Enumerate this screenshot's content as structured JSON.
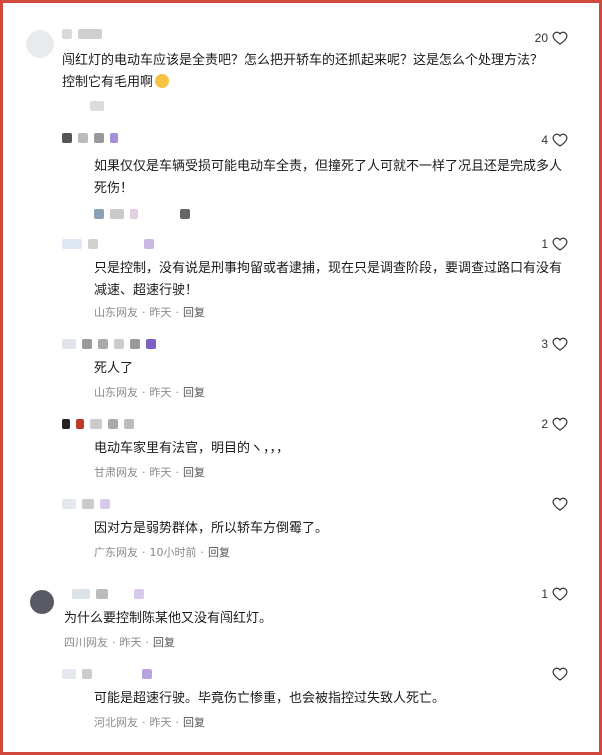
{
  "comments": [
    {
      "likes": "20",
      "text": "闯红灯的电动车应该是全责吧？怎么把开轿车的还抓起来呢？这是怎么个处理方法？控制它有毛用啊"
    },
    {
      "likes": "4",
      "text": "如果仅仅是车辆受损可能电动车全责，但撞死了人可就不一样了况且还是完成多人死伤！"
    },
    {
      "likes": "1",
      "text": "只是控制，没有说是刑事拘留或者逮捕，现在只是调查阶段，要调查过路口有没有减速、超速行驶！",
      "meta": {
        "region": "山东网友",
        "time": "昨天",
        "reply": "回复"
      }
    },
    {
      "likes": "3",
      "text": "死人了",
      "meta": {
        "region": "山东网友",
        "time": "昨天",
        "reply": "回复"
      }
    },
    {
      "likes": "2",
      "text": "电动车家里有法官，明目的ヽ，，，",
      "meta": {
        "region": "甘肃网友",
        "time": "昨天",
        "reply": "回复"
      }
    },
    {
      "likes": "",
      "text": "因对方是弱势群体，所以轿车方倒霉了。",
      "meta": {
        "region": "广东网友",
        "time": "10小时前",
        "reply": "回复"
      }
    },
    {
      "likes": "1",
      "text": "为什么要控制陈某他又没有闯红灯。",
      "meta": {
        "region": "四川网友",
        "time": "昨天",
        "reply": "回复"
      }
    },
    {
      "likes": "",
      "text": "可能是超速行驶。毕竟伤亡惨重，也会被指控过失致人死亡。",
      "meta": {
        "region": "河北网友",
        "time": "昨天",
        "reply": "回复"
      }
    }
  ],
  "separator": "·",
  "colors": {
    "border": "#d2493e",
    "meta": "#8a8a8a",
    "text": "#1a1a1a"
  },
  "icons": {
    "like": "heart-outline-icon",
    "emoji": "laughing-face-icon"
  }
}
